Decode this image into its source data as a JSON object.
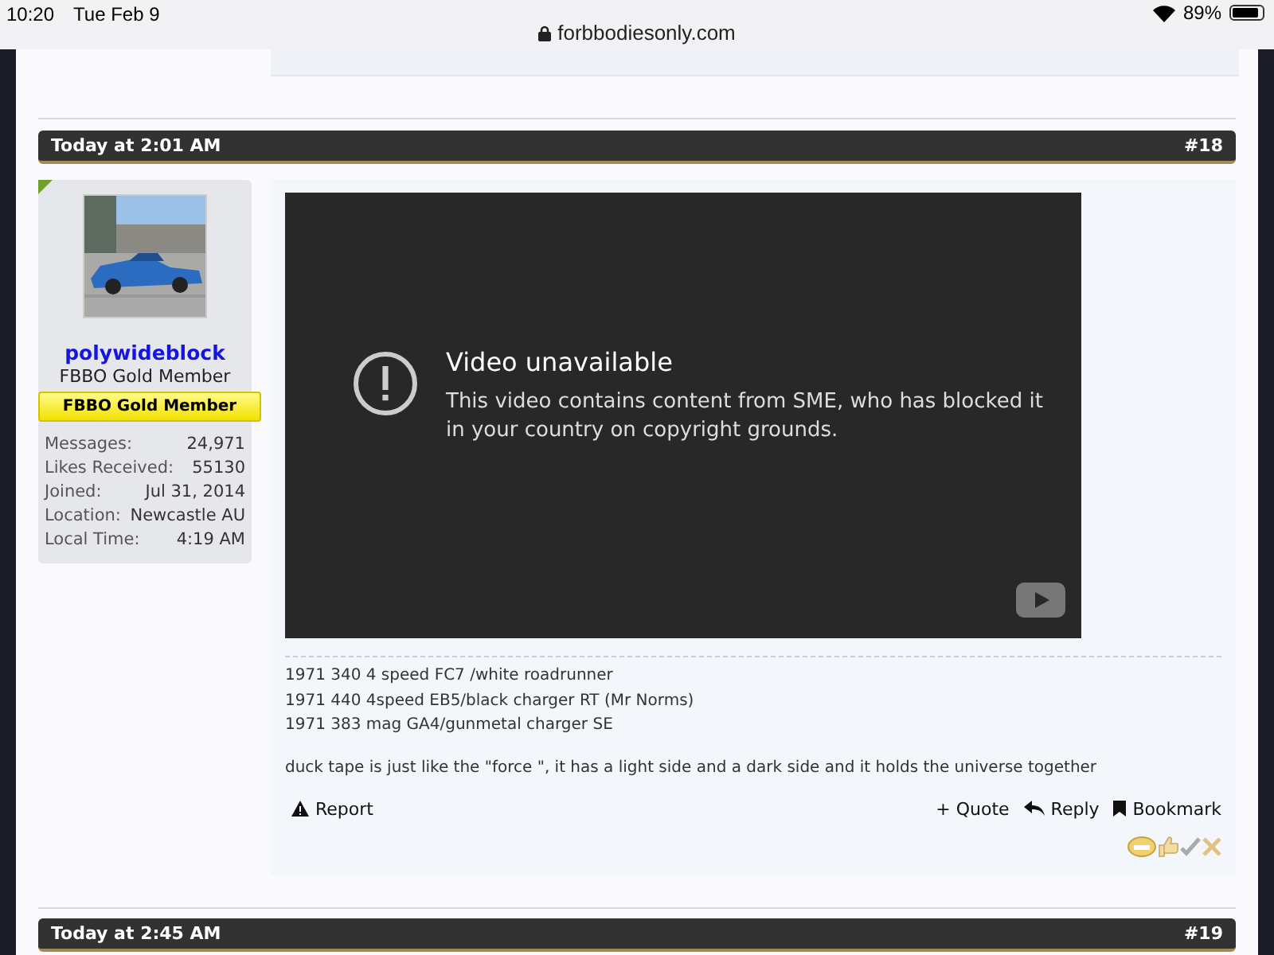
{
  "status_bar": {
    "time": "10:20",
    "date": "Tue Feb 9",
    "url": "forbbodiesonly.com",
    "battery": "89%"
  },
  "posts": [
    {
      "date": "Today at 2:01 AM",
      "number": "#18",
      "online": true,
      "user": {
        "name": "polywideblock",
        "title": "FBBO Gold Member",
        "banner": "FBBO Gold Member",
        "stats": [
          {
            "label": "Messages:",
            "value": "24,971"
          },
          {
            "label": "Likes Received:",
            "value": "55130"
          },
          {
            "label": "Joined:",
            "value": "Jul 31, 2014"
          },
          {
            "label": "Location:",
            "value": "Newcastle AU"
          },
          {
            "label": "Local Time:",
            "value": "4:19 AM"
          }
        ]
      },
      "video": {
        "title": "Video unavailable",
        "message": "This video contains content from SME, who has blocked it in your country on copyright grounds."
      },
      "signature": [
        "1971 340 4 speed FC7 /white roadrunner",
        "1971 440 4speed EB5/black charger RT (Mr Norms)",
        "1971 383 mag GA4/gunmetal charger SE"
      ],
      "quote": "duck tape is just like the \"force \", it has a light side and a dark side and it holds the universe together",
      "actions": [
        {
          "kind": "report",
          "label": "Report"
        },
        {
          "kind": "quote",
          "label": "+ Quote"
        },
        {
          "kind": "reply",
          "label": "Reply"
        },
        {
          "kind": "bookmark",
          "label": "Bookmark"
        }
      ]
    },
    {
      "date": "Today at 2:45 AM",
      "number": "#19"
    }
  ]
}
